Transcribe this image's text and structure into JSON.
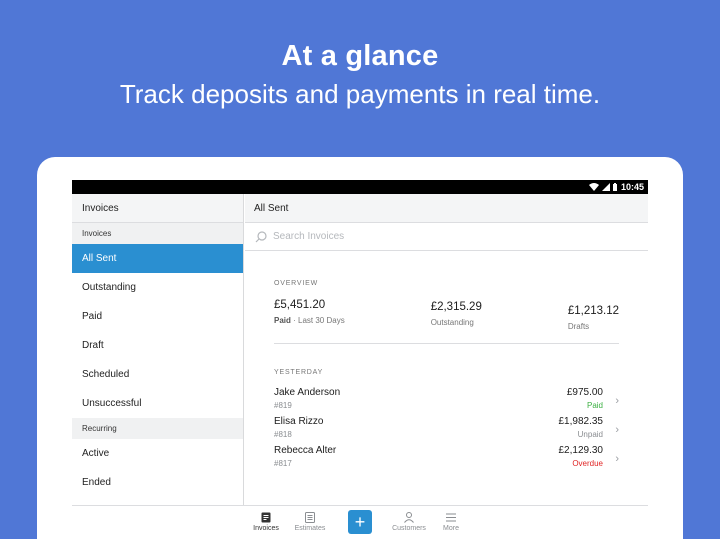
{
  "hero": {
    "title": "At a glance",
    "subtitle": "Track deposits and payments in real time."
  },
  "status_bar": {
    "time": "10:45"
  },
  "sidebar": {
    "header": "Invoices",
    "sections": [
      {
        "label": "Invoices",
        "items": [
          "All Sent",
          "Outstanding",
          "Paid",
          "Draft",
          "Scheduled",
          "Unsuccessful"
        ]
      },
      {
        "label": "Recurring",
        "items": [
          "Active",
          "Ended"
        ]
      }
    ],
    "active_item": "All Sent"
  },
  "main": {
    "header": "All Sent",
    "search_placeholder": "Search Invoices",
    "overview": {
      "label": "OVERVIEW",
      "stats": [
        {
          "amount": "£5,451.20",
          "label_strong": "Paid",
          "label_rest": " · Last 30 Days"
        },
        {
          "amount": "£2,315.29",
          "label": "Outstanding"
        },
        {
          "amount": "£1,213.12",
          "label": "Drafts"
        }
      ]
    },
    "group_label": "YESTERDAY",
    "invoices": [
      {
        "name": "Jake Anderson",
        "number": "#819",
        "amount": "£975.00",
        "status": "Paid",
        "status_color": "#3cb043"
      },
      {
        "name": "Elisa Rizzo",
        "number": "#818",
        "amount": "£1,982.35",
        "status": "Unpaid",
        "status_color": "#8a8d91"
      },
      {
        "name": "Rebecca Alter",
        "number": "#817",
        "amount": "£2,129.30",
        "status": "Overdue",
        "status_color": "#e02424"
      }
    ]
  },
  "bottom_nav": {
    "items": [
      {
        "label": "Invoices",
        "icon": "invoice-icon",
        "active": true
      },
      {
        "label": "Estimates",
        "icon": "estimate-icon",
        "active": false
      },
      {
        "label": "Customers",
        "icon": "person-icon",
        "active": false
      },
      {
        "label": "More",
        "icon": "menu-icon",
        "active": false
      }
    ],
    "fab_icon": "plus-icon"
  },
  "colors": {
    "background": "#5077d6",
    "accent": "#2a8fd1",
    "paid": "#3cb043",
    "overdue": "#e02424"
  }
}
